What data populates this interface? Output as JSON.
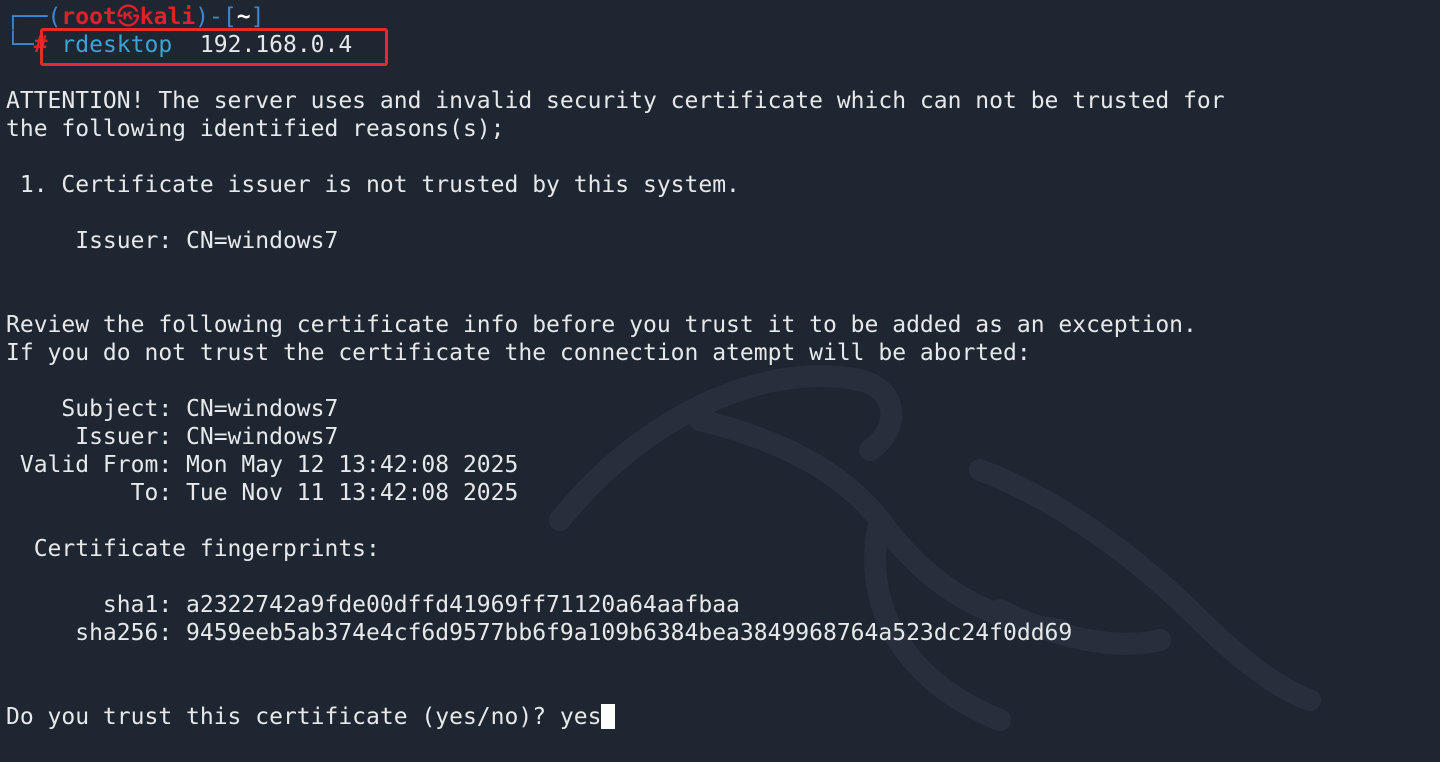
{
  "prompt": {
    "decor_top": "┌──(",
    "user": "root",
    "skull": "㉿",
    "host": "kali",
    "decor_mid": ")-[",
    "dir": "~",
    "decor_close": "]",
    "decor_bottom": "└─",
    "symbol": "#"
  },
  "command": {
    "name": "rdesktop",
    "argument": "192.168.0.4"
  },
  "output": {
    "attention_line1": "ATTENTION! The server uses and invalid security certificate which can not be trusted for",
    "attention_line2": "the following identified reasons(s);",
    "reason_1": " 1. Certificate issuer is not trusted by this system.",
    "reason_issuer": "     Issuer: CN=windows7",
    "review_line1": "Review the following certificate info before you trust it to be added as an exception.",
    "review_line2": "If you do not trust the certificate the connection atempt will be aborted:",
    "cert_subject": "    Subject: CN=windows7",
    "cert_issuer": "     Issuer: CN=windows7",
    "cert_valid_from": " Valid From: Mon May 12 13:42:08 2025",
    "cert_valid_to": "         To: Tue Nov 11 13:42:08 2025",
    "fingerprints_heading": "  Certificate fingerprints:",
    "sha1": "       sha1: a2322742a9fde00dffd41969ff71120a64aafbaa",
    "sha256": "     sha256: 9459eeb5ab374e4cf6d9577bb6f9a109b6384bea3849968764a523dc24f0dd69",
    "trust_question": "Do you trust this certificate (yes/no)? ",
    "trust_answer": "yes"
  },
  "colors": {
    "background": "#1e2631",
    "text": "#e6e8ea",
    "prompt_red": "#e0202a",
    "prompt_blue": "#3c87d0",
    "command_blue": "#3ba4d6",
    "highlight_box": "#ea2a2a"
  }
}
